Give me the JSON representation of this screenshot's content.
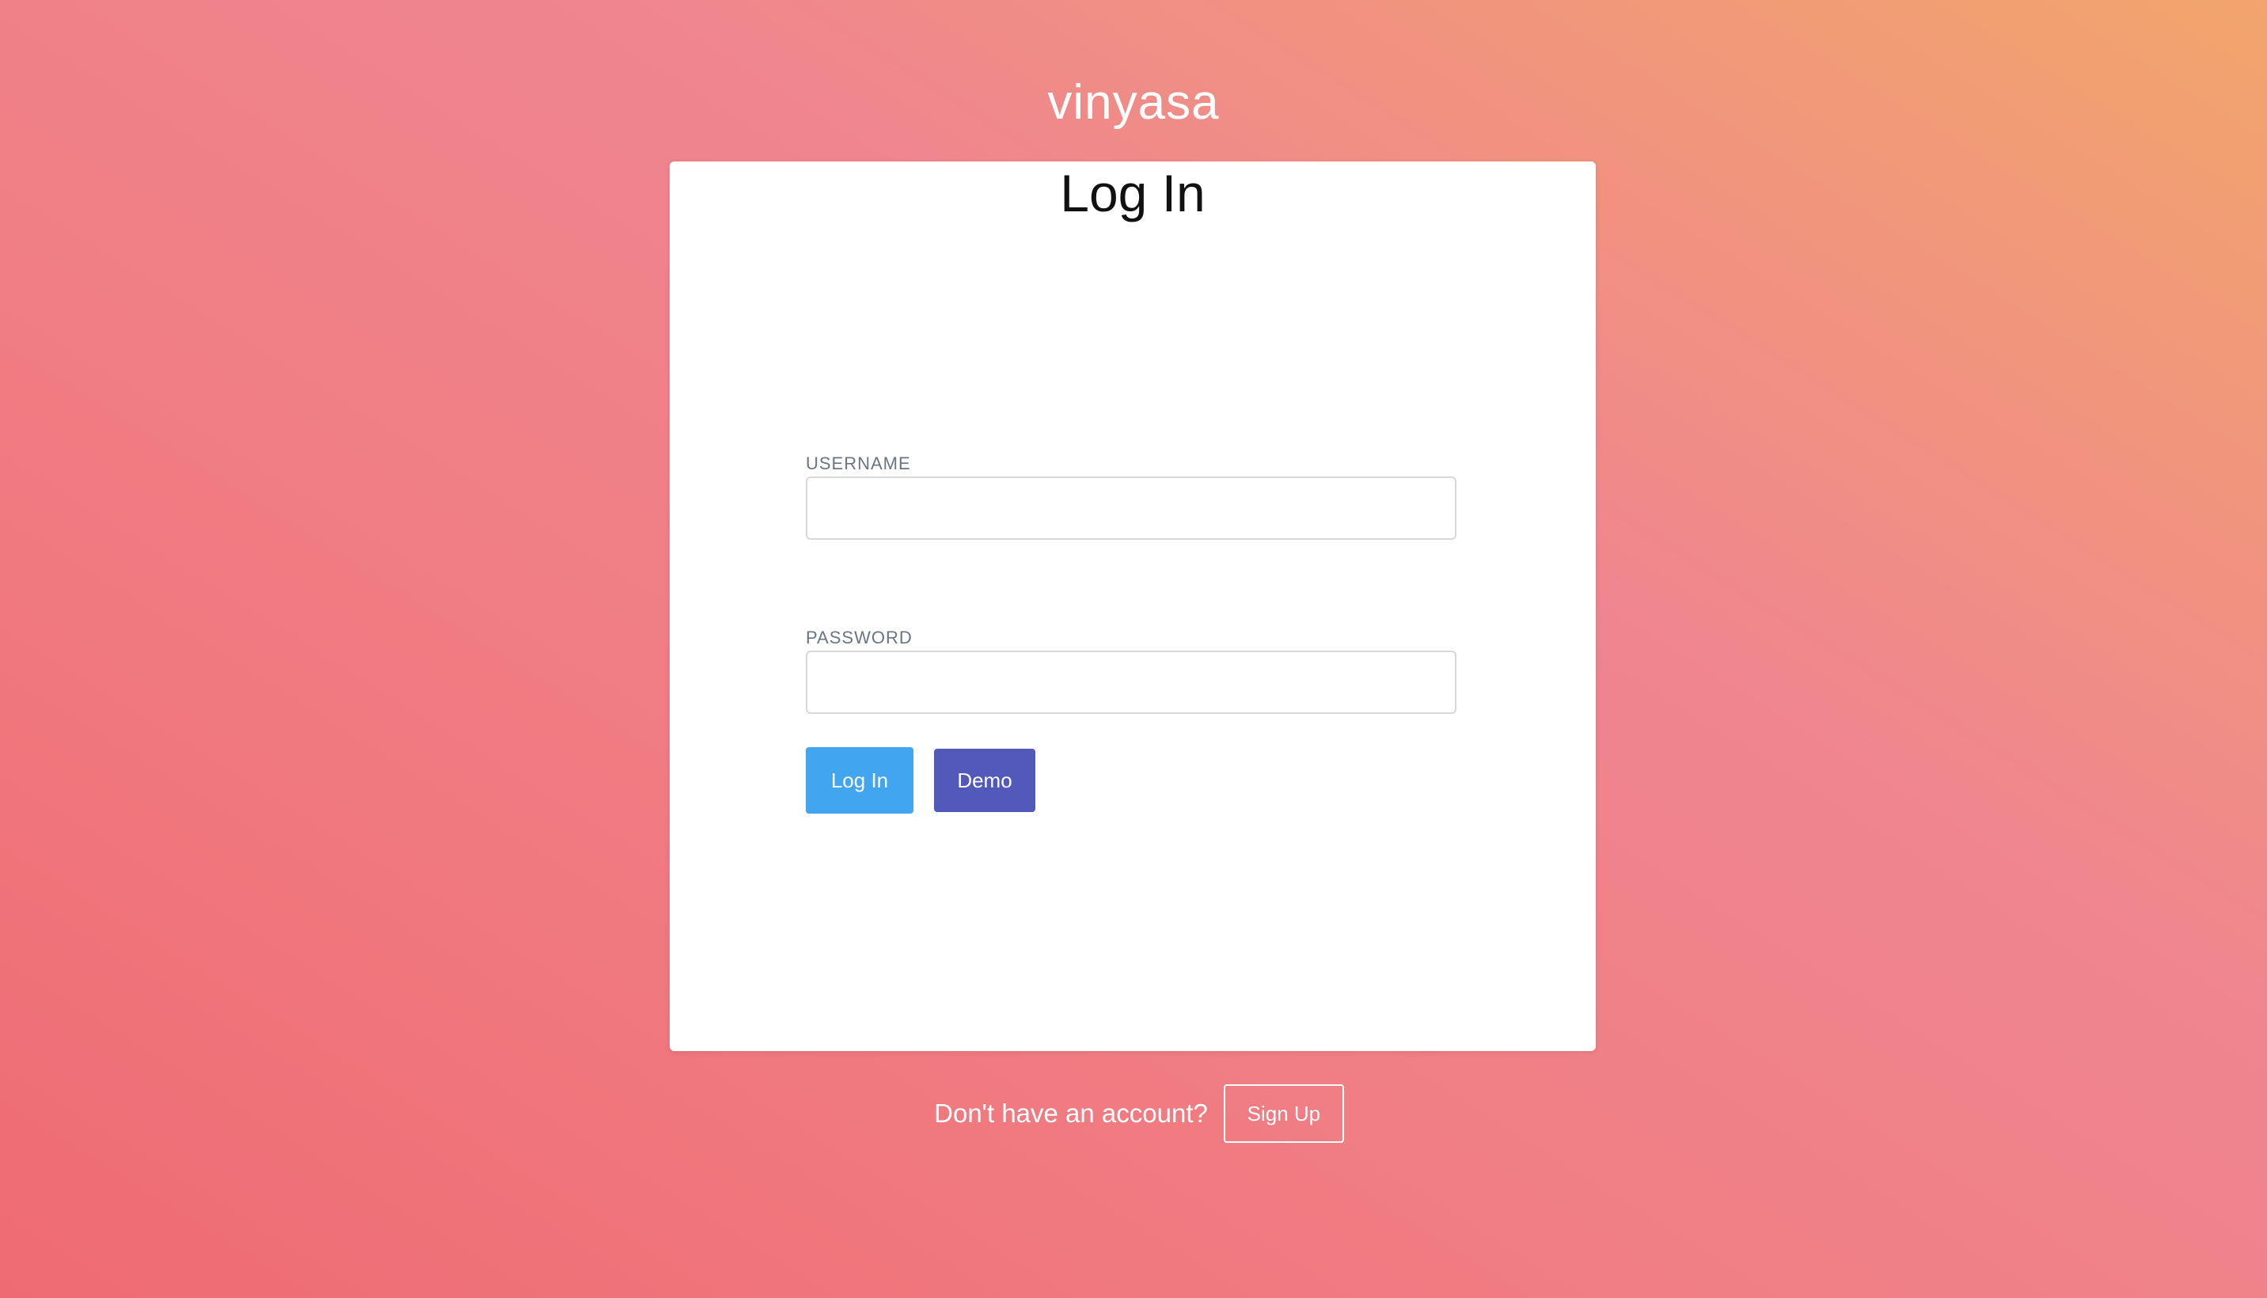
{
  "app": {
    "title": "vinyasa"
  },
  "login": {
    "heading": "Log In",
    "username_label": "USERNAME",
    "username_value": "",
    "password_label": "PASSWORD",
    "password_value": "",
    "login_button": "Log In",
    "demo_button": "Demo"
  },
  "footer": {
    "prompt": "Don't have an account?",
    "signup_button": "Sign Up"
  },
  "colors": {
    "login_button": "#42a5f0",
    "demo_button": "#5359b9",
    "background_start": "#ef6b73",
    "background_end": "#f2a56c"
  }
}
